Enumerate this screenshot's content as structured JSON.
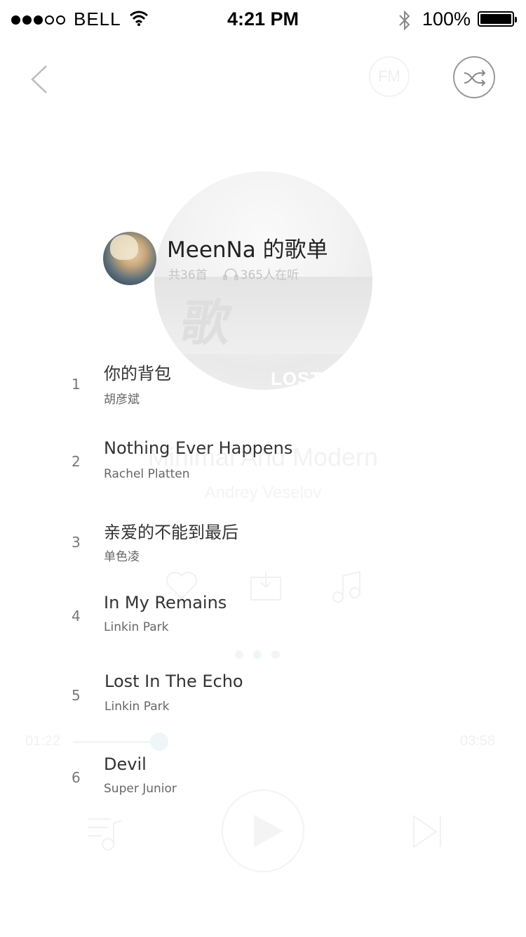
{
  "status_bar": {
    "carrier": "BELL",
    "time": "4:21 PM",
    "battery": "100%"
  },
  "nav": {
    "fm_label": "FM"
  },
  "background_player": {
    "album_text": "LOST",
    "song_title": "Minimal And Modern",
    "artist": "Andrey Veselov",
    "elapsed": "01:22",
    "duration": "03:58"
  },
  "playlist": {
    "owner_title": "MeenNa 的歌单",
    "track_count": "共36首",
    "listeners": "365人在听"
  },
  "tracks": [
    {
      "number": "1",
      "title": "你的背包",
      "artist": "胡彦斌"
    },
    {
      "number": "2",
      "title": "Nothing Ever Happens",
      "artist": "Rachel Platten"
    },
    {
      "number": "3",
      "title": "亲爱的不能到最后",
      "artist": "单色凌"
    },
    {
      "number": "4",
      "title": "In My Remains",
      "artist": "Linkin Park"
    },
    {
      "number": "5",
      "title": "Lost In The Echo",
      "artist": "Linkin Park"
    },
    {
      "number": "6",
      "title": "Devil",
      "artist": "Super Junior"
    }
  ],
  "icons": {
    "back": "chevron-left-icon",
    "shuffle": "shuffle-icon",
    "listeners": "headphones-icon"
  },
  "colors": {
    "accent_faded": "#eef6f8",
    "text_primary": "#333333",
    "text_secondary": "#666666",
    "meta": "#c4c4c4"
  }
}
